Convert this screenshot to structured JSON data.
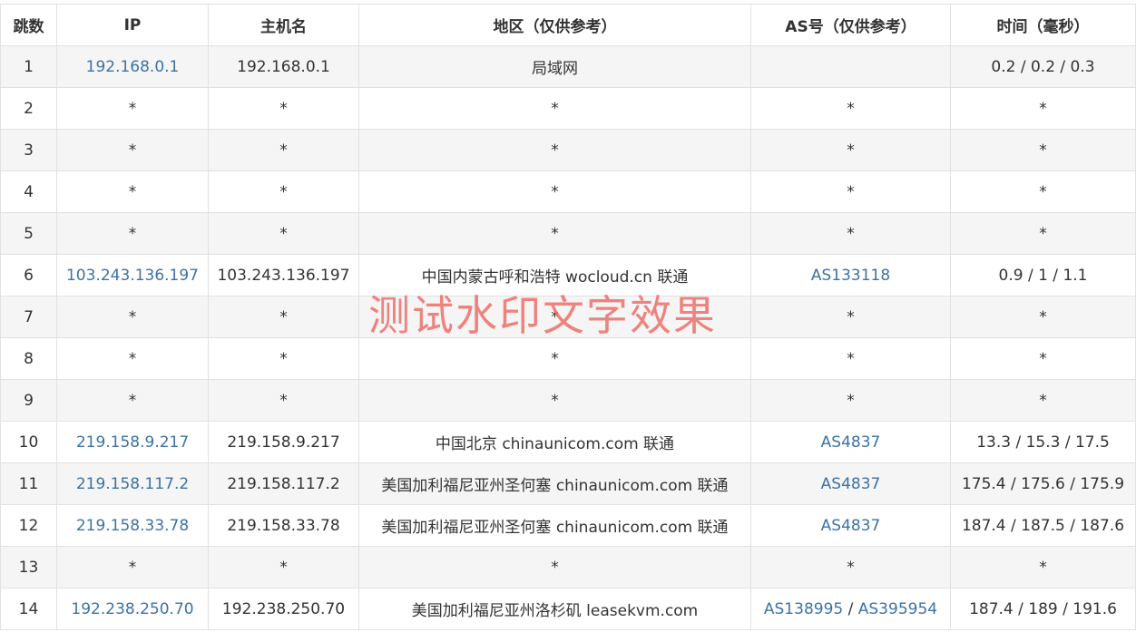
{
  "colors": {
    "link": "#3b73a6",
    "watermark": "#ec6e69",
    "stripe": "#f5f5f5",
    "border": "#e1e1e1"
  },
  "headers": [
    "跳数",
    "IP",
    "主机名",
    "地区（仅供参考）",
    "AS号（仅供参考）",
    "时间（毫秒）"
  ],
  "rows": [
    {
      "hop": "1",
      "ip": "192.168.0.1",
      "ip_link": true,
      "host": "192.168.0.1",
      "region": "局域网",
      "as": [],
      "time": "0.2 / 0.2 / 0.3"
    },
    {
      "hop": "2",
      "ip": "*",
      "ip_link": false,
      "host": "*",
      "region": "*",
      "as_text": "*",
      "as": [],
      "time": "*"
    },
    {
      "hop": "3",
      "ip": "*",
      "ip_link": false,
      "host": "*",
      "region": "*",
      "as_text": "*",
      "as": [],
      "time": "*"
    },
    {
      "hop": "4",
      "ip": "*",
      "ip_link": false,
      "host": "*",
      "region": "*",
      "as_text": "*",
      "as": [],
      "time": "*"
    },
    {
      "hop": "5",
      "ip": "*",
      "ip_link": false,
      "host": "*",
      "region": "*",
      "as_text": "*",
      "as": [],
      "time": "*"
    },
    {
      "hop": "6",
      "ip": "103.243.136.197",
      "ip_link": true,
      "host": "103.243.136.197",
      "region": "中国内蒙古呼和浩特 wocloud.cn 联通",
      "as": [
        "AS133118"
      ],
      "time": "0.9 / 1 / 1.1"
    },
    {
      "hop": "7",
      "ip": "*",
      "ip_link": false,
      "host": "*",
      "region": "*",
      "as_text": "*",
      "as": [],
      "time": "*"
    },
    {
      "hop": "8",
      "ip": "*",
      "ip_link": false,
      "host": "*",
      "region": "*",
      "as_text": "*",
      "as": [],
      "time": "*"
    },
    {
      "hop": "9",
      "ip": "*",
      "ip_link": false,
      "host": "*",
      "region": "*",
      "as_text": "*",
      "as": [],
      "time": "*"
    },
    {
      "hop": "10",
      "ip": "219.158.9.217",
      "ip_link": true,
      "host": "219.158.9.217",
      "region": "中国北京 chinaunicom.com 联通",
      "as": [
        "AS4837"
      ],
      "time": "13.3 / 15.3 / 17.5"
    },
    {
      "hop": "11",
      "ip": "219.158.117.2",
      "ip_link": true,
      "host": "219.158.117.2",
      "region": "美国加利福尼亚州圣何塞 chinaunicom.com 联通",
      "as": [
        "AS4837"
      ],
      "time": "175.4 / 175.6 / 175.9"
    },
    {
      "hop": "12",
      "ip": "219.158.33.78",
      "ip_link": true,
      "host": "219.158.33.78",
      "region": "美国加利福尼亚州圣何塞 chinaunicom.com 联通",
      "as": [
        "AS4837"
      ],
      "time": "187.4 / 187.5 / 187.6"
    },
    {
      "hop": "13",
      "ip": "*",
      "ip_link": false,
      "host": "*",
      "region": "*",
      "as_text": "*",
      "as": [],
      "time": "*"
    },
    {
      "hop": "14",
      "ip": "192.238.250.70",
      "ip_link": true,
      "host": "192.238.250.70",
      "region": "美国加利福尼亚州洛杉矶 leasekvm.com",
      "as": [
        "AS138995",
        "AS395954"
      ],
      "time": "187.4 / 189 / 191.6"
    }
  ],
  "as_separator": " / ",
  "watermark": "测试水印文字效果"
}
